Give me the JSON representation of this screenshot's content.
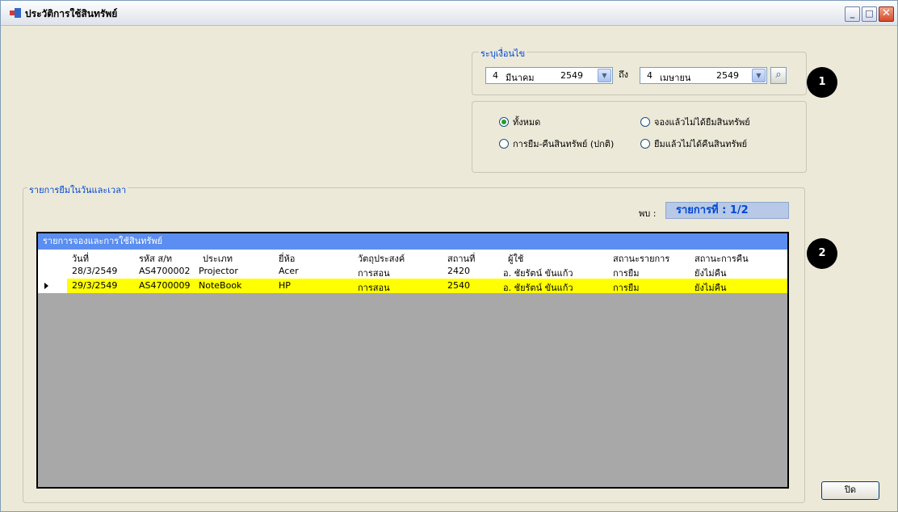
{
  "window": {
    "title": "ประวัติการใช้สินทรัพย์",
    "controls": {
      "minimize": "_",
      "maximize": "□",
      "close": "✕"
    }
  },
  "filter": {
    "legend": "ระบุเงื่อนไข",
    "from": {
      "day": "4",
      "month": "มีนาคม",
      "year": "2549"
    },
    "to_label": "ถึง",
    "to": {
      "day": "4",
      "month": "เมษายน",
      "year": "2549"
    },
    "search_icon": "magnifier-icon"
  },
  "options": {
    "all": "ทั้งหมด",
    "reserved_not_borrowed": "จองแล้วไม่ได้ยืมสินทรัพย์",
    "borrow_return_normal": "การยืม-คืนสินทรัพย์ (ปกติ)",
    "borrowed_not_returned": "ยืมแล้วไม่ได้คืนสินทรัพย์",
    "selected": "all"
  },
  "badges": {
    "one": "1",
    "two": "2"
  },
  "list": {
    "legend": "รายการยืมในวันและเวลา",
    "found_label": "พบ :",
    "found_value": "รายการที่ : 1/2"
  },
  "grid": {
    "caption": "รายการจองและการใช้สินทรัพย์",
    "headers": [
      "วันที่",
      "รหัส ส/ท",
      "ประเภท",
      "ยี่ห้อ",
      "วัตถุประสงค์",
      "สถานที่",
      "ผู้ใช้",
      "สถานะรายการ",
      "สถานะการคืน"
    ],
    "rows": [
      [
        "28/3/2549",
        "AS4700002",
        "Projector",
        "Acer",
        "การสอน",
        "2420",
        "อ. ชัยรัตน์ ขันแก้ว",
        "การยืม",
        "ยังไม่คืน"
      ],
      [
        "29/3/2549",
        "AS4700009",
        "NoteBook",
        "HP",
        "การสอน",
        "2540",
        "อ. ชัยรัตน์ ขันแก้ว",
        "การยืม",
        "ยังไม่คืน"
      ]
    ],
    "colors": {
      "caption_bg": "#5b8ef0",
      "selected_row": "#ffff00",
      "empty_area": "#a8a8a8"
    }
  },
  "close_button": "ปิด"
}
